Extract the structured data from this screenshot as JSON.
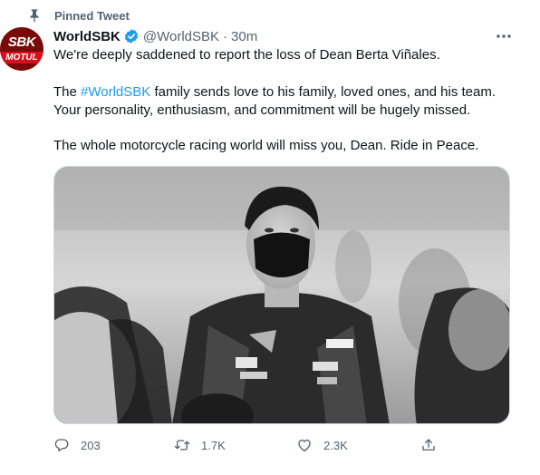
{
  "pinned": {
    "label": "Pinned Tweet"
  },
  "author": {
    "name": "WorldSBK",
    "handle": "@WorldSBK",
    "separator": "·",
    "time": "30m",
    "avatar_text": "SBK",
    "avatar_subtext": "MOTUL"
  },
  "tweet": {
    "line1": "We're deeply saddened to report the loss of Dean Berta Viñales.",
    "line2_pre": "The ",
    "line2_hashtag": "#WorldSBK",
    "line2_post": " family sends love to his family, loved ones, and his team.",
    "line3": "Your personality, enthusiasm, and commitment will be hugely missed.",
    "line4": "The whole motorcycle racing world will miss you, Dean. Ride in Peace."
  },
  "actions": {
    "reply_count": "203",
    "retweet_count": "1.7K",
    "like_count": "2.3K"
  },
  "colors": {
    "accent": "#1d9bf0",
    "secondary_text": "#536471",
    "primary_text": "#0f1419"
  },
  "icons": [
    "pin-icon",
    "verified-icon",
    "more-icon",
    "reply-icon",
    "retweet-icon",
    "like-icon",
    "share-icon"
  ]
}
